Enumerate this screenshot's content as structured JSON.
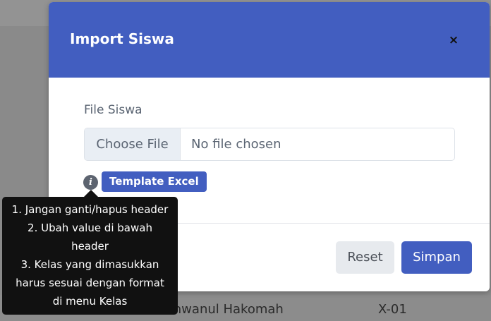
{
  "background": {
    "row_name": "Aerin Unwanul Hakomah",
    "row_class": "X-01"
  },
  "modal": {
    "title": "Import Siswa",
    "close_label": "×",
    "field_label": "File Siswa",
    "choose_file_label": "Choose File",
    "file_status": "No file chosen",
    "info_icon_glyph": "i",
    "template_button_label": "Template Excel",
    "reset_label": "Reset",
    "save_label": "Simpan"
  },
  "tooltip": {
    "lines": [
      "1. Jangan ganti/hapus header",
      "2. Ubah value di bawah",
      "header",
      "3. Kelas yang dimasukkan",
      "harus sesuai dengan format",
      "di menu Kelas"
    ]
  },
  "colors": {
    "accent": "#425ec0",
    "backdrop": "#8a8a8a",
    "tooltip": "#111111"
  }
}
